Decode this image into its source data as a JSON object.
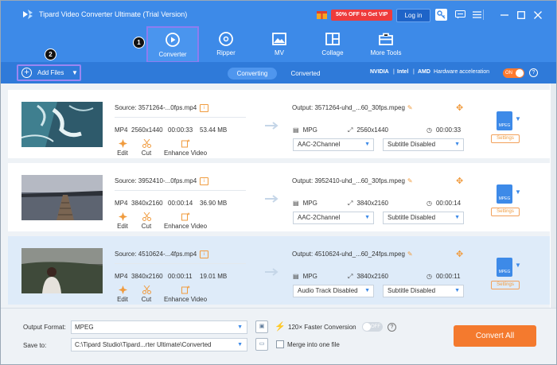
{
  "app": {
    "title": "Tipard Video Converter Ultimate (Trial Version)",
    "promo": "50% OFF to Get VIP",
    "login": "Log in"
  },
  "nav": {
    "items": [
      {
        "label": "Converter",
        "icon": "converter-icon",
        "active": true
      },
      {
        "label": "Ripper",
        "icon": "disc-icon"
      },
      {
        "label": "MV",
        "icon": "image-icon"
      },
      {
        "label": "Collage",
        "icon": "collage-icon"
      },
      {
        "label": "More Tools",
        "icon": "toolbox-icon"
      }
    ]
  },
  "steps": {
    "one": "1",
    "two": "2"
  },
  "toolbar": {
    "add_files": "Add Files",
    "tabs": [
      "Converting",
      "Converted"
    ],
    "hw_nvidia": "NVIDIA",
    "hw_intel": "Intel",
    "hw_amd": "AMD",
    "hw_label": "Hardware acceleration",
    "hw_toggle": "ON",
    "help": "?"
  },
  "files": [
    {
      "source": "Source: 3571264-...0fps.mp4",
      "format": "MP4",
      "resolution": "2560x1440",
      "duration": "00:00:33",
      "size": "53.44 MB",
      "output": "Output: 3571264-uhd_...60_30fps.mpeg",
      "out_format": "MPG",
      "out_resolution": "2560x1440",
      "out_duration": "00:00:33",
      "audio": "AAC-2Channel",
      "subtitle": "Subtitle Disabled"
    },
    {
      "source": "Source: 3952410-...0fps.mp4",
      "format": "MP4",
      "resolution": "3840x2160",
      "duration": "00:00:14",
      "size": "36.90 MB",
      "output": "Output: 3952410-uhd_...60_30fps.mpeg",
      "out_format": "MPG",
      "out_resolution": "3840x2160",
      "out_duration": "00:00:14",
      "audio": "AAC-2Channel",
      "subtitle": "Subtitle Disabled"
    },
    {
      "source": "Source: 4510624-...4fps.mp4",
      "format": "MP4",
      "resolution": "3840x2160",
      "duration": "00:00:11",
      "size": "19.01 MB",
      "output": "Output: 4510624-uhd_...60_24fps.mpeg",
      "out_format": "MPG",
      "out_resolution": "3840x2160",
      "out_duration": "00:00:11",
      "audio": "Audio Track Disabled",
      "subtitle": "Subtitle Disabled"
    }
  ],
  "row_actions": {
    "edit": "Edit",
    "cut": "Cut",
    "enhance": "Enhance Video",
    "settings": "Settings",
    "format_badge": "MPEG"
  },
  "footer": {
    "output_format_label": "Output Format:",
    "output_format": "MPEG",
    "save_to_label": "Save to:",
    "save_path": "C:\\Tipard Studio\\Tipard...rter Ultimate\\Converted",
    "faster": "120× Faster Conversion",
    "faster_toggle": "OFF",
    "merge": "Merge into one file",
    "convert_all": "Convert All"
  },
  "colors": {
    "primary": "#3d8ae8",
    "accent": "#f47a2e",
    "highlight": "#8e7cf0"
  }
}
